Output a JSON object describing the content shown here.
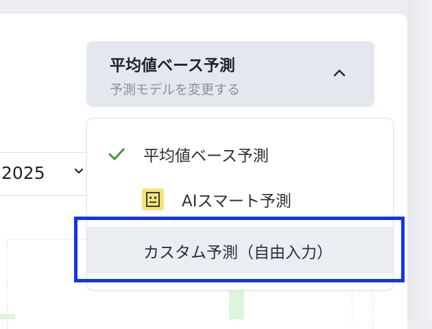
{
  "year_select": {
    "value": "2025"
  },
  "model_selector": {
    "title": "平均値ベース予測",
    "subtitle": "予測モデルを変更する"
  },
  "menu": {
    "items": [
      {
        "label": "平均値ベース予測",
        "selected": true,
        "icon": "check-icon"
      },
      {
        "label": "AIスマート予測",
        "selected": false,
        "icon": "robot-icon"
      },
      {
        "label": "カスタム予測（自由入力）",
        "selected": false,
        "icon": ""
      }
    ]
  },
  "colors": {
    "accent_highlight": "#1434e6",
    "check_green": "#3a9a3a",
    "robot_yellow": "#f6e27a",
    "trigger_bg": "#e3e7ee",
    "hover_bg": "#eaeef3"
  }
}
